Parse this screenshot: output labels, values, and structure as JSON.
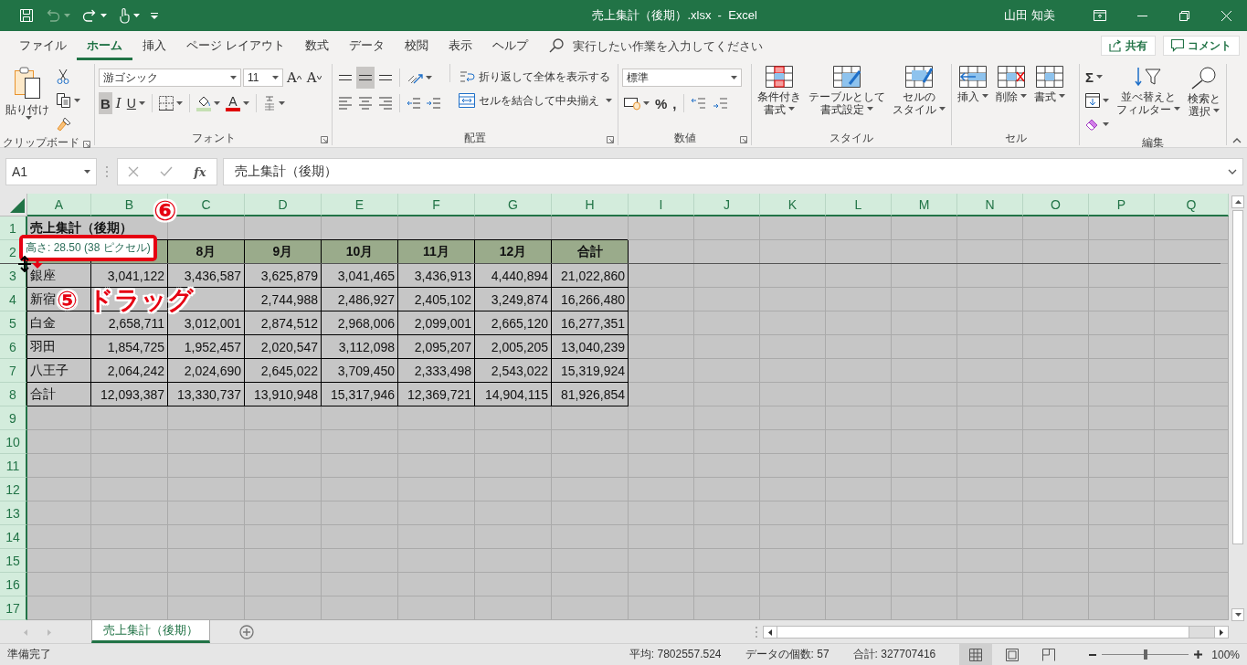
{
  "title_bar": {
    "undo_disabled": true,
    "title": "売上集計（後期）.xlsx  -  Excel",
    "user": "山田 知美"
  },
  "menu_tabs": [
    {
      "label": "ファイル",
      "selected": false
    },
    {
      "label": "ホーム",
      "selected": true
    },
    {
      "label": "挿入",
      "selected": false
    },
    {
      "label": "ページ レイアウト",
      "selected": false
    },
    {
      "label": "数式",
      "selected": false
    },
    {
      "label": "データ",
      "selected": false
    },
    {
      "label": "校閲",
      "selected": false
    },
    {
      "label": "表示",
      "selected": false
    },
    {
      "label": "ヘルプ",
      "selected": false
    }
  ],
  "tell_me": {
    "placeholder": "実行したい作業を入力してください"
  },
  "share_button": "共有",
  "comment_button": "コメント",
  "ribbon": {
    "clipboard": {
      "label": "クリップボード",
      "paste": "貼り付け"
    },
    "font": {
      "label": "フォント",
      "font_name": "游ゴシック",
      "font_size": "11",
      "grow": "A",
      "shrink": "A",
      "bold": "B",
      "bold_on": true,
      "italic": "I",
      "underline": "U",
      "font_color": "A"
    },
    "alignment": {
      "label": "配置",
      "vertical": [
        {
          "selected": false
        },
        {
          "selected": true
        },
        {
          "selected": false
        }
      ],
      "wrap_text": "折り返して全体を表示する",
      "merge_center": "セルを結合して中央揃え"
    },
    "number": {
      "label": "数値",
      "format": "標準",
      "percent": "%",
      "comma": ","
    },
    "styles": {
      "label": "スタイル",
      "buttons": [
        {
          "lines": [
            "条件付き",
            "書式"
          ]
        },
        {
          "lines": [
            "テーブルとして",
            "書式設定"
          ]
        },
        {
          "lines": [
            "セルの",
            "スタイル"
          ]
        }
      ]
    },
    "cells": {
      "label": "セル",
      "buttons": [
        {
          "lines": [
            "挿入"
          ]
        },
        {
          "lines": [
            "削除"
          ]
        },
        {
          "lines": [
            "書式"
          ]
        }
      ]
    },
    "editing": {
      "label": "編集",
      "sum": "Σ",
      "buttons": [
        {
          "lines": [
            "並べ替えと",
            "フィルター"
          ]
        },
        {
          "lines": [
            "検索と",
            "選択"
          ]
        }
      ]
    }
  },
  "formula_bar": {
    "name_box": "A1",
    "fx": "fx",
    "formula": "売上集計（後期）"
  },
  "sheet": {
    "columns": [
      "A",
      "B",
      "C",
      "D",
      "E",
      "F",
      "G",
      "H",
      "I",
      "J",
      "K",
      "L",
      "M",
      "N",
      "O",
      "P",
      "Q"
    ],
    "rows": [
      {
        "header": "1",
        "cells": [
          {
            "kind": "title",
            "text": "売上集計（後期）"
          }
        ]
      },
      {
        "header": "2",
        "cells": [
          {
            "kind": "header"
          },
          {
            "kind": "header"
          },
          {
            "kind": "header",
            "text": "8月"
          },
          {
            "kind": "header",
            "text": "9月"
          },
          {
            "kind": "header",
            "text": "10月"
          },
          {
            "kind": "header",
            "text": "11月"
          },
          {
            "kind": "header",
            "text": "12月"
          },
          {
            "kind": "header",
            "text": "合計"
          }
        ]
      },
      {
        "header": "3",
        "cells": [
          {
            "kind": "text",
            "text": "銀座"
          },
          {
            "kind": "number",
            "text": "3,041,122"
          },
          {
            "kind": "number",
            "text": "3,436,587"
          },
          {
            "kind": "number",
            "text": "3,625,879"
          },
          {
            "kind": "number",
            "text": "3,041,465"
          },
          {
            "kind": "number",
            "text": "3,436,913"
          },
          {
            "kind": "number",
            "text": "4,440,894"
          },
          {
            "kind": "number",
            "text": "21,022,860"
          }
        ]
      },
      {
        "header": "4",
        "cells": [
          {
            "kind": "text",
            "text": "新宿"
          },
          {
            "kind": "covered"
          },
          {
            "kind": "covered"
          },
          {
            "kind": "number",
            "text": "2,744,988"
          },
          {
            "kind": "number",
            "text": "2,486,927"
          },
          {
            "kind": "number",
            "text": "2,405,102"
          },
          {
            "kind": "number",
            "text": "3,249,874"
          },
          {
            "kind": "number",
            "text": "16,266,480"
          }
        ]
      },
      {
        "header": "5",
        "cells": [
          {
            "kind": "text",
            "text": "白金"
          },
          {
            "kind": "number",
            "text": "2,658,711"
          },
          {
            "kind": "number",
            "text": "3,012,001"
          },
          {
            "kind": "number",
            "text": "2,874,512"
          },
          {
            "kind": "number",
            "text": "2,968,006"
          },
          {
            "kind": "number",
            "text": "2,099,001"
          },
          {
            "kind": "number",
            "text": "2,665,120"
          },
          {
            "kind": "number",
            "text": "16,277,351"
          }
        ]
      },
      {
        "header": "6",
        "cells": [
          {
            "kind": "text",
            "text": "羽田"
          },
          {
            "kind": "number",
            "text": "1,854,725"
          },
          {
            "kind": "number",
            "text": "1,952,457"
          },
          {
            "kind": "number",
            "text": "2,020,547"
          },
          {
            "kind": "number",
            "text": "3,112,098"
          },
          {
            "kind": "number",
            "text": "2,095,207"
          },
          {
            "kind": "number",
            "text": "2,005,205"
          },
          {
            "kind": "number",
            "text": "13,040,239"
          }
        ]
      },
      {
        "header": "7",
        "cells": [
          {
            "kind": "text",
            "text": "八王子"
          },
          {
            "kind": "number",
            "text": "2,064,242"
          },
          {
            "kind": "number",
            "text": "2,024,690"
          },
          {
            "kind": "number",
            "text": "2,645,022"
          },
          {
            "kind": "number",
            "text": "3,709,450"
          },
          {
            "kind": "number",
            "text": "2,333,498"
          },
          {
            "kind": "number",
            "text": "2,543,022"
          },
          {
            "kind": "number",
            "text": "15,319,924"
          }
        ]
      },
      {
        "header": "8",
        "cells": [
          {
            "kind": "text",
            "text": "合計"
          },
          {
            "kind": "number",
            "text": "12,093,387"
          },
          {
            "kind": "number",
            "text": "13,330,737"
          },
          {
            "kind": "number",
            "text": "13,910,948"
          },
          {
            "kind": "number",
            "text": "15,317,946"
          },
          {
            "kind": "number",
            "text": "12,369,721"
          },
          {
            "kind": "number",
            "text": "14,904,115"
          },
          {
            "kind": "number",
            "text": "81,926,854"
          }
        ]
      },
      {
        "header": "9"
      },
      {
        "header": "10"
      },
      {
        "header": "11"
      },
      {
        "header": "12"
      },
      {
        "header": "13"
      },
      {
        "header": "14"
      },
      {
        "header": "15"
      },
      {
        "header": "16"
      },
      {
        "header": "17"
      }
    ]
  },
  "tooltip": "高さ: 28.50 (38 ピクセル)",
  "annotations": [
    {
      "text": "⑥"
    },
    {
      "text": "⑤"
    },
    {
      "text": "ドラッグ"
    }
  ],
  "sheet_tabs": [
    {
      "label": "売上集計（後期）",
      "selected": true
    }
  ],
  "status_bar": {
    "status": "準備完了",
    "average": "平均: 7802557.524",
    "count": "データの個数: 57",
    "sum": "合計: 327707416",
    "views": [
      {
        "selected": true
      },
      {
        "selected": false
      },
      {
        "selected": false
      }
    ],
    "zoom_slider": {
      "level": 0.5
    },
    "zoom": "100%"
  }
}
